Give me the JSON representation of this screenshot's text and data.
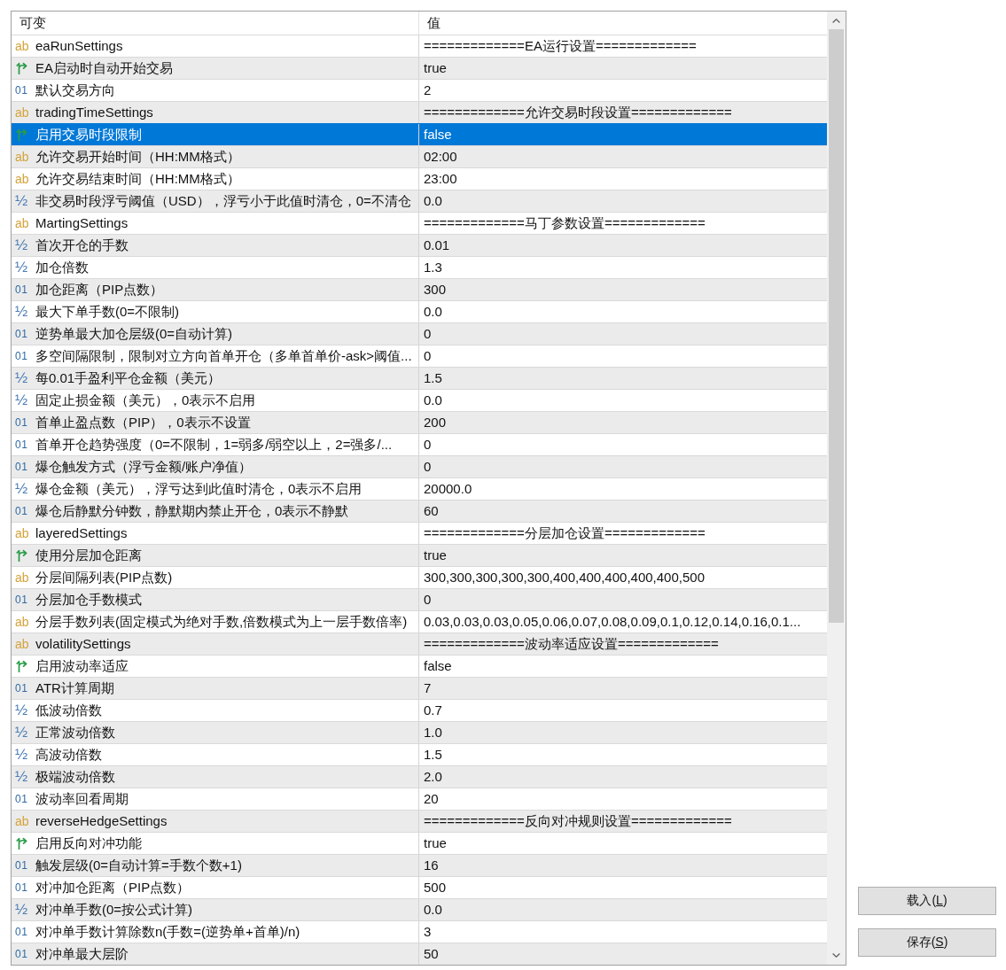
{
  "table": {
    "columns": [
      "可变",
      "值"
    ],
    "rows": [
      {
        "kind": "string",
        "icon": "ab",
        "name": "eaRunSettings",
        "value": "=============EA运行设置=============",
        "selected": false
      },
      {
        "kind": "bool",
        "name": "EA启动时自动开始交易",
        "value": "true",
        "selected": false
      },
      {
        "kind": "int",
        "icon": "01",
        "name": "默认交易方向",
        "value": "2",
        "selected": false
      },
      {
        "kind": "string",
        "icon": "ab",
        "name": "tradingTimeSettings",
        "value": "=============允许交易时段设置=============",
        "selected": false
      },
      {
        "kind": "bool",
        "name": "启用交易时段限制",
        "value": "false",
        "selected": true
      },
      {
        "kind": "string",
        "icon": "ab",
        "name": "允许交易开始时间（HH:MM格式）",
        "value": "02:00",
        "selected": false
      },
      {
        "kind": "string",
        "icon": "ab",
        "name": "允许交易结束时间（HH:MM格式）",
        "value": "23:00",
        "selected": false
      },
      {
        "kind": "double",
        "icon": "½",
        "name": "非交易时段浮亏阈值（USD），浮亏小于此值时清仓，0=不清仓",
        "value": "0.0",
        "selected": false
      },
      {
        "kind": "string",
        "icon": "ab",
        "name": "MartingSettings",
        "value": "=============马丁参数设置=============",
        "selected": false
      },
      {
        "kind": "double",
        "icon": "½",
        "name": "首次开仓的手数",
        "value": "0.01",
        "selected": false
      },
      {
        "kind": "double",
        "icon": "½",
        "name": "加仓倍数",
        "value": "1.3",
        "selected": false
      },
      {
        "kind": "int",
        "icon": "01",
        "name": "加仓距离（PIP点数）",
        "value": "300",
        "selected": false
      },
      {
        "kind": "double",
        "icon": "½",
        "name": "最大下单手数(0=不限制)",
        "value": "0.0",
        "selected": false
      },
      {
        "kind": "int",
        "icon": "01",
        "name": "逆势单最大加仓层级(0=自动计算)",
        "value": "0",
        "selected": false
      },
      {
        "kind": "int",
        "icon": "01",
        "name": "多空间隔限制，限制对立方向首单开仓（多单首单价-ask>阈值...",
        "value": "0",
        "selected": false
      },
      {
        "kind": "double",
        "icon": "½",
        "name": "每0.01手盈利平仓金额（美元）",
        "value": "1.5",
        "selected": false
      },
      {
        "kind": "double",
        "icon": "½",
        "name": "固定止损金额（美元），0表示不启用",
        "value": "0.0",
        "selected": false
      },
      {
        "kind": "int",
        "icon": "01",
        "name": "首单止盈点数（PIP），0表示不设置",
        "value": "200",
        "selected": false
      },
      {
        "kind": "int",
        "icon": "01",
        "name": "首单开仓趋势强度（0=不限制，1=弱多/弱空以上，2=强多/...",
        "value": "0",
        "selected": false
      },
      {
        "kind": "int",
        "icon": "01",
        "name": "爆仓触发方式（浮亏金额/账户净值）",
        "value": "0",
        "selected": false
      },
      {
        "kind": "double",
        "icon": "½",
        "name": "爆仓金额（美元），浮亏达到此值时清仓，0表示不启用",
        "value": "20000.0",
        "selected": false
      },
      {
        "kind": "int",
        "icon": "01",
        "name": "爆仓后静默分钟数，静默期内禁止开仓，0表示不静默",
        "value": "60",
        "selected": false
      },
      {
        "kind": "string",
        "icon": "ab",
        "name": "layeredSettings",
        "value": "=============分层加仓设置=============",
        "selected": false
      },
      {
        "kind": "bool",
        "name": "使用分层加仓距离",
        "value": "true",
        "selected": false
      },
      {
        "kind": "string",
        "icon": "ab",
        "name": "分层间隔列表(PIP点数)",
        "value": "300,300,300,300,300,400,400,400,400,400,500",
        "selected": false
      },
      {
        "kind": "int",
        "icon": "01",
        "name": "分层加仓手数模式",
        "value": "0",
        "selected": false
      },
      {
        "kind": "string",
        "icon": "ab",
        "name": "分层手数列表(固定模式为绝对手数,倍数模式为上一层手数倍率)",
        "value": "0.03,0.03,0.03,0.05,0.06,0.07,0.08,0.09,0.1,0.12,0.14,0.16,0.1...",
        "selected": false
      },
      {
        "kind": "string",
        "icon": "ab",
        "name": "volatilitySettings",
        "value": "=============波动率适应设置=============",
        "selected": false
      },
      {
        "kind": "bool",
        "name": "启用波动率适应",
        "value": "false",
        "selected": false
      },
      {
        "kind": "int",
        "icon": "01",
        "name": "ATR计算周期",
        "value": "7",
        "selected": false
      },
      {
        "kind": "double",
        "icon": "½",
        "name": "低波动倍数",
        "value": "0.7",
        "selected": false
      },
      {
        "kind": "double",
        "icon": "½",
        "name": "正常波动倍数",
        "value": "1.0",
        "selected": false
      },
      {
        "kind": "double",
        "icon": "½",
        "name": "高波动倍数",
        "value": "1.5",
        "selected": false
      },
      {
        "kind": "double",
        "icon": "½",
        "name": "极端波动倍数",
        "value": "2.0",
        "selected": false
      },
      {
        "kind": "int",
        "icon": "01",
        "name": "波动率回看周期",
        "value": "20",
        "selected": false
      },
      {
        "kind": "string",
        "icon": "ab",
        "name": "reverseHedgeSettings",
        "value": "=============反向对冲规则设置=============",
        "selected": false
      },
      {
        "kind": "bool",
        "name": "启用反向对冲功能",
        "value": "true",
        "selected": false
      },
      {
        "kind": "int",
        "icon": "01",
        "name": "触发层级(0=自动计算=手数个数+1)",
        "value": "16",
        "selected": false
      },
      {
        "kind": "int",
        "icon": "01",
        "name": "对冲加仓距离（PIP点数）",
        "value": "500",
        "selected": false
      },
      {
        "kind": "double",
        "icon": "½",
        "name": "对冲单手数(0=按公式计算)",
        "value": "0.0",
        "selected": false
      },
      {
        "kind": "int",
        "icon": "01",
        "name": "对冲单手数计算除数n(手数=(逆势单+首单)/n)",
        "value": "3",
        "selected": false
      },
      {
        "kind": "int",
        "icon": "01",
        "name": "对冲单最大层阶",
        "value": "50",
        "selected": false
      }
    ]
  },
  "buttons": [
    {
      "before": "载入(",
      "mnemonic": "L",
      "after": ")"
    },
    {
      "before": "保存(",
      "mnemonic": "S",
      "after": ")"
    }
  ]
}
